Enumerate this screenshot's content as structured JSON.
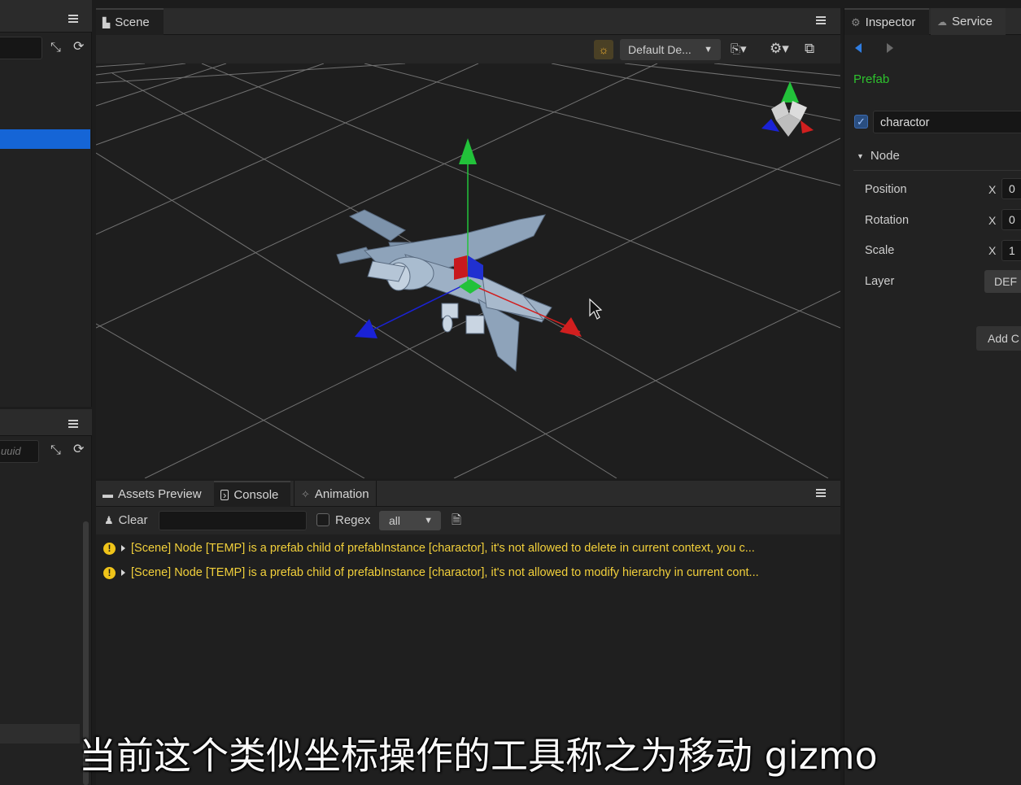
{
  "scene": {
    "tab_label": "Scene",
    "camera_dropdown": "Default De...",
    "axis_colors": {
      "x": "#d11f1f",
      "y": "#22c23a",
      "z": "#1a22d6"
    }
  },
  "bottom_tabs": {
    "assets_preview": "Assets Preview",
    "console": "Console",
    "animation": "Animation"
  },
  "console": {
    "clear_label": "Clear",
    "filter_value": "",
    "regex_label": "Regex",
    "level_select": "all",
    "messages": [
      {
        "level": "warning",
        "text": "[Scene] Node [TEMP] is a prefab child of prefabInstance [charactor], it's not allowed to delete in current context, you c..."
      },
      {
        "level": "warning",
        "text": "[Scene] Node [TEMP] is a prefab child of prefabInstance [charactor], it's not allowed to modify hierarchy in current cont..."
      }
    ],
    "warning_color": "#f2d03b"
  },
  "left_panels": {
    "lower_search_placeholder": "uuid"
  },
  "inspector": {
    "tab_inspector": "Inspector",
    "tab_service": "Service",
    "prefab_label": "Prefab",
    "prefab_color": "#2ec22e",
    "node_name": "charactor",
    "node_enabled": true,
    "section_label": "Node",
    "properties": [
      {
        "label": "Position",
        "axis": "X",
        "value": "0"
      },
      {
        "label": "Rotation",
        "axis": "X",
        "value": "0"
      },
      {
        "label": "Scale",
        "axis": "X",
        "value": "1"
      }
    ],
    "layer_label": "Layer",
    "layer_value": "DEF",
    "add_component_label": "Add C"
  },
  "subtitle": "当前这个类似坐标操作的工具称之为移动 gizmo"
}
